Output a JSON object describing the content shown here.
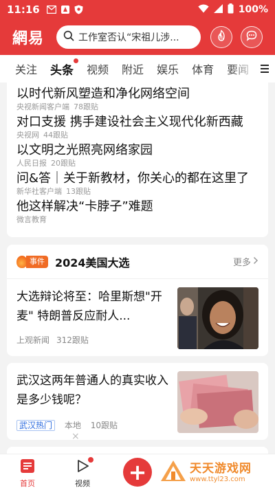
{
  "status_bar": {
    "time": "11:16",
    "battery": "100%"
  },
  "header": {
    "logo": "網易",
    "search_placeholder": "工作室否认“宋祖儿涉...",
    "hot_icon_label": "热"
  },
  "tabs": [
    {
      "label": "关注"
    },
    {
      "label": "头条"
    },
    {
      "label": "视频"
    },
    {
      "label": "附近"
    },
    {
      "label": "娱乐"
    },
    {
      "label": "体育"
    },
    {
      "label": "要闻"
    }
  ],
  "headlines": [
    {
      "title": "以时代新风塑造和净化网络空间",
      "source": "央视新闻客户端",
      "comments": "78跟贴"
    },
    {
      "title": "对口支援 携手建设社会主义现代化新西藏",
      "source": "央视网",
      "comments": "44跟贴"
    },
    {
      "title": "以文明之光照亮网络家园",
      "source": "人民日报",
      "comments": "20跟贴"
    },
    {
      "title": "问&答｜关于新教材，你关心的都在这里了",
      "source": "新华社客户端",
      "comments": "13跟贴"
    },
    {
      "title": "他这样解决“卡脖子”难题",
      "source": "微言教育",
      "comments": ""
    }
  ],
  "event": {
    "tag": "事件",
    "title": "2024美国大选",
    "more": "更多",
    "article": {
      "title": "大选辩论将至：哈里斯想\"开麦\" 特朗普反应耐人...",
      "source": "上观新闻",
      "comments": "312跟贴"
    }
  },
  "article2": {
    "title": "武汉这两年普通人的真实收入是多少钱呢？",
    "tag": "武汉热门",
    "location": "本地",
    "comments": "10跟贴",
    "dismiss": "×"
  },
  "bottom_nav": {
    "home": "首页",
    "video": "视频",
    "fab": "+"
  },
  "watermark": {
    "name": "天天游戏网",
    "url": "www.ttyl23.com"
  },
  "colors": {
    "brand_red": "#e53a3a",
    "event_orange": "#f06b24",
    "tag_blue": "#2d6cdf"
  }
}
